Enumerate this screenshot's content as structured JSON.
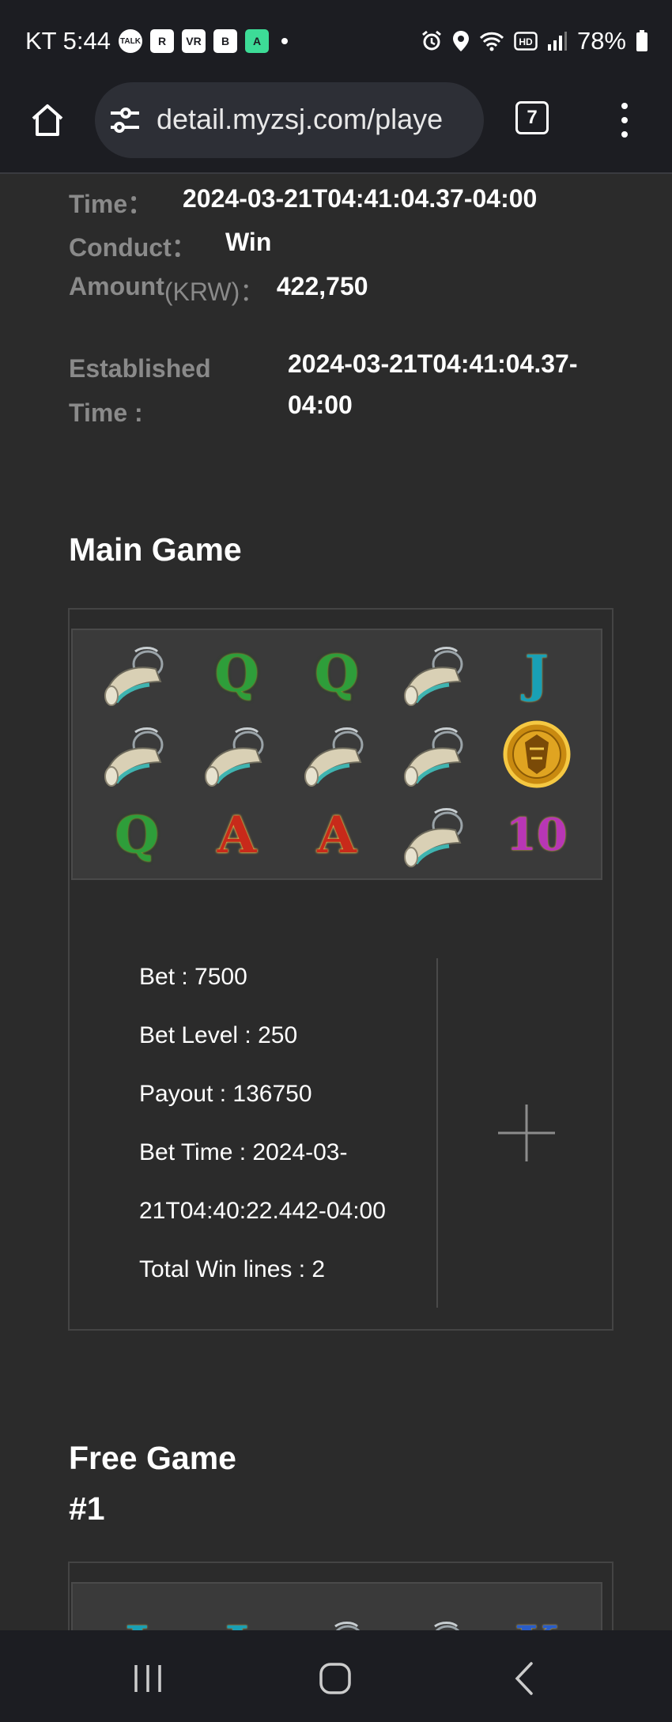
{
  "status_bar": {
    "carrier_time": "KT 5:44",
    "icons": [
      "talk-icon",
      "r-icon",
      "vr-icon",
      "b-icon",
      "a-icon"
    ],
    "app_icon_labels": [
      "TALK",
      "R",
      "VR",
      "B",
      "A"
    ],
    "battery": "78%",
    "right_icons": [
      "alarm-icon",
      "location-icon",
      "wifi-icon",
      "hd-icon",
      "signal-icon",
      "battery-icon"
    ]
  },
  "browser": {
    "url": "detail.myzsj.com/playe",
    "tab_count": "7"
  },
  "record": {
    "time_label": "Time：",
    "time_value": "2024-03-21T04:41:04.37-04:00",
    "conduct_label": "Conduct：",
    "conduct_value": "Win",
    "amount_label": "Amount",
    "amount_unit": "(KRW)：",
    "amount_value": "422,750",
    "established_label_1": "Established",
    "established_label_2": "Time :",
    "established_value_1": "2024-03-21T04:41:04.37-",
    "established_value_2": "04:00"
  },
  "main_game": {
    "title": "Main Game",
    "reels": [
      [
        "horn",
        "Q",
        "Q",
        "horn",
        "J"
      ],
      [
        "horn",
        "horn",
        "horn",
        "horn",
        "coin"
      ],
      [
        "Q",
        "A",
        "A",
        "horn",
        "10"
      ]
    ],
    "details": {
      "bet": "Bet : 7500",
      "bet_level": "Bet Level : 250",
      "payout": "Payout : 136750",
      "bet_time_1": "Bet Time : 2024-03-",
      "bet_time_2": "21T04:40:22.442-04:00",
      "total_win_lines": "Total Win lines : 2"
    }
  },
  "free_game": {
    "title_1": "Free Game",
    "title_2": "#1",
    "reels_top_row": [
      "J",
      "J",
      "horn",
      "horn",
      "K"
    ]
  },
  "colors": {
    "background": "#2b2b2b",
    "chrome": "#1c1d22",
    "label_gray": "#8a8a8a"
  }
}
